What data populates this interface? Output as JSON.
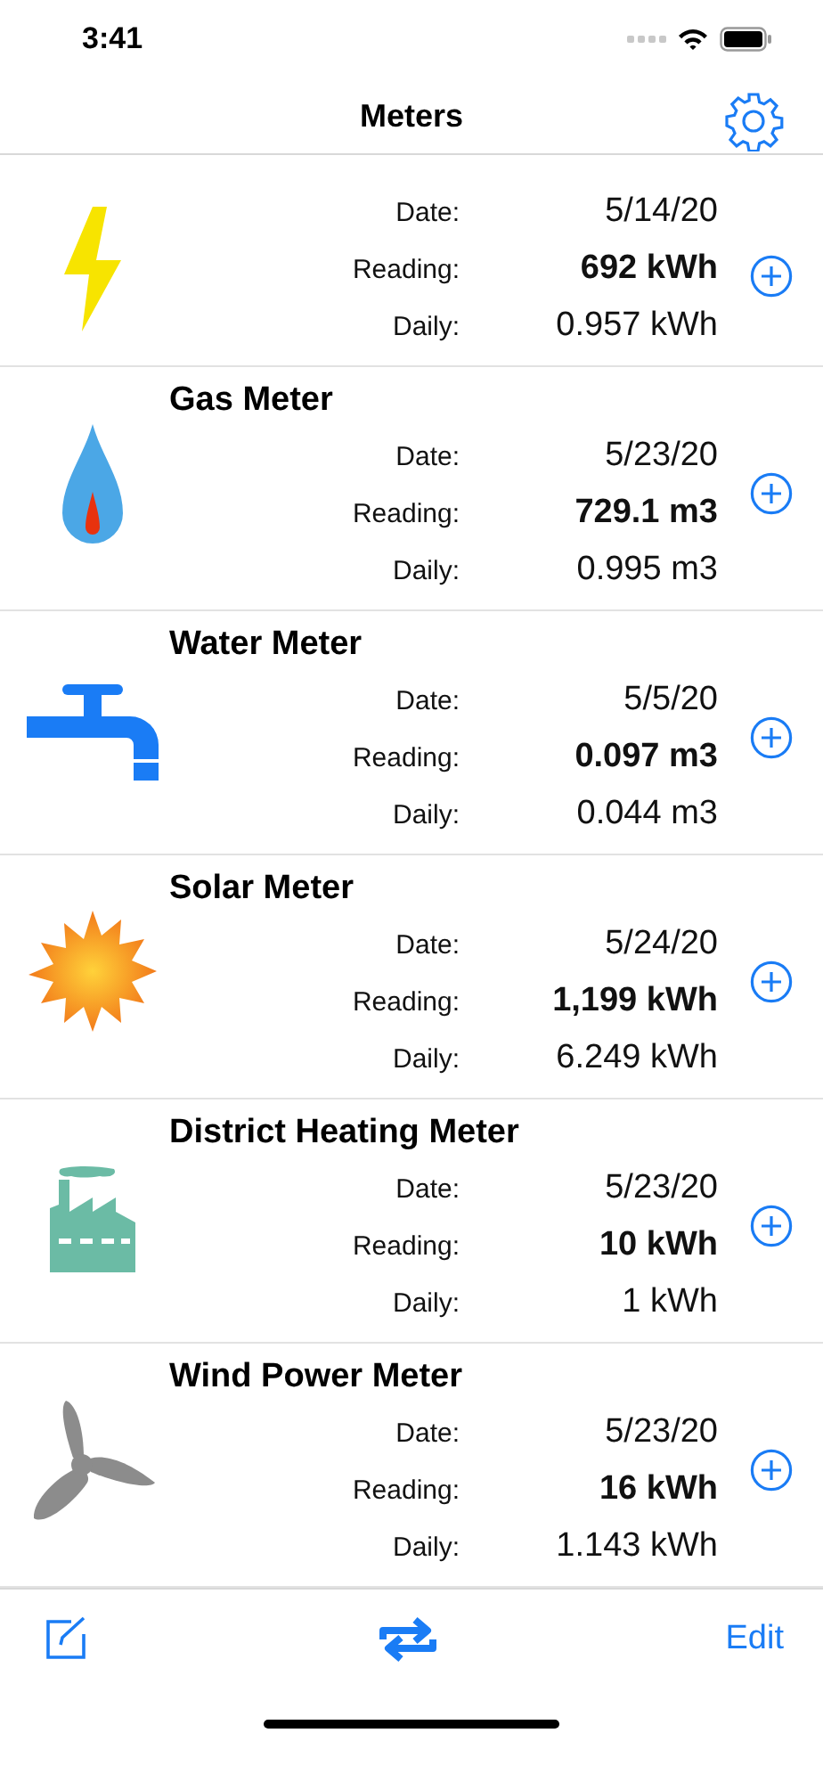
{
  "status_bar": {
    "time": "3:41"
  },
  "nav_bar": {
    "title": "Meters"
  },
  "meters": [
    {
      "kind": "electric",
      "date_label": "Date:",
      "date": "5/14/20",
      "reading_label": "Reading:",
      "reading": "692 kWh",
      "daily_label": "Daily:",
      "daily": "0.957 kWh"
    },
    {
      "kind": "gas",
      "name": "Gas Meter",
      "date_label": "Date:",
      "date": "5/23/20",
      "reading_label": "Reading:",
      "reading": "729.1 m3",
      "daily_label": "Daily:",
      "daily": "0.995 m3"
    },
    {
      "kind": "water",
      "name": "Water Meter",
      "date_label": "Date:",
      "date": "5/5/20",
      "reading_label": "Reading:",
      "reading": "0.097 m3",
      "daily_label": "Daily:",
      "daily": "0.044 m3"
    },
    {
      "kind": "solar",
      "name": "Solar Meter",
      "date_label": "Date:",
      "date": "5/24/20",
      "reading_label": "Reading:",
      "reading": "1,199 kWh",
      "daily_label": "Daily:",
      "daily": "6.249 kWh"
    },
    {
      "kind": "heating",
      "name": "District Heating Meter",
      "date_label": "Date:",
      "date": "5/23/20",
      "reading_label": "Reading:",
      "reading": "10 kWh",
      "daily_label": "Daily:",
      "daily": "1 kWh"
    },
    {
      "kind": "wind",
      "name": "Wind Power Meter",
      "date_label": "Date:",
      "date": "5/23/20",
      "reading_label": "Reading:",
      "reading": "16 kWh",
      "daily_label": "Daily:",
      "daily": "1.143 kWh"
    }
  ],
  "toolbar": {
    "edit_label": "Edit"
  }
}
